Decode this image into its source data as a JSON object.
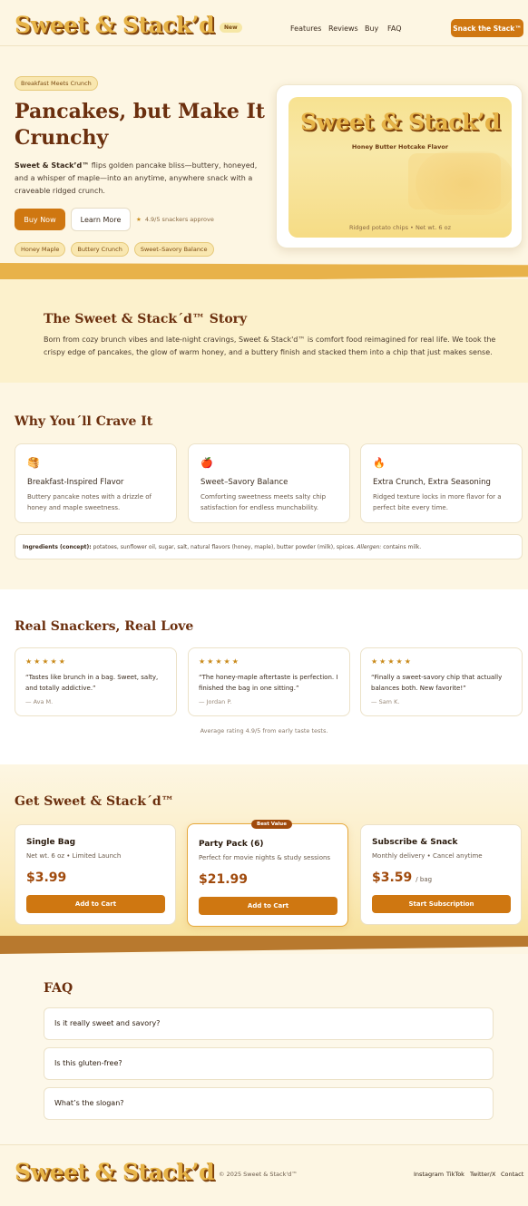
{
  "header": {
    "logo": "Sweet & Stack’d",
    "badge": "New",
    "nav": [
      "Features",
      "Reviews",
      "Buy",
      "FAQ"
    ],
    "cta": "Snack the Stack™"
  },
  "hero": {
    "tag": "Breakfast Meets Crunch",
    "title": "Pancakes, but Make It Crunchy",
    "desc_brand": "Sweet & Stack’d™",
    "desc_rest": " flips golden pancake bliss—buttery, honeyed, and a whisper of maple—into an anytime, anywhere snack with a craveable ridged crunch.",
    "buy_label": "Buy Now",
    "learn_label": "Learn More",
    "rating_text": "4.9/5 snackers approve",
    "flavor_tags": [
      "Honey Maple",
      "Buttery Crunch",
      "Sweet–Savory Balance"
    ]
  },
  "product": {
    "logo": "Sweet & Stack’d",
    "flavor": "Honey Butter Hotcake Flavor",
    "footer": "Ridged potato chips • Net wt. 6 oz"
  },
  "story": {
    "title": "The Sweet & Stack´d™ Story",
    "body": "Born from cozy brunch vibes and late-night cravings, Sweet & Stack'd™ is comfort food reimagined for real life. We took the crispy edge of pancakes, the glow of warm honey, and a buttery finish and stacked them into a chip that just makes sense."
  },
  "why": {
    "title": "Why You´ll Crave It",
    "features": [
      {
        "icon": "pancake-icon",
        "glyph": "🥞",
        "title": "Breakfast-Inspired Flavor",
        "desc": "Buttery pancake notes with a drizzle of honey and maple sweetness."
      },
      {
        "icon": "apple-icon",
        "glyph": "🍎",
        "title": "Sweet–Savory Balance",
        "desc": "Comforting sweetness meets salty chip satisfaction for endless munchability."
      },
      {
        "icon": "fire-icon",
        "glyph": "🔥",
        "title": "Extra Crunch, Extra Seasoning",
        "desc": "Ridged texture locks in more flavor for a perfect bite every time."
      }
    ],
    "ingredients_label": "Ingredients (concept):",
    "ingredients_text": " potatoes, sunflower oil, sugar, salt, natural flavors (honey, maple), butter powder (milk), spices. ",
    "allergen_label": "Allergen:",
    "allergen_text": " contains milk."
  },
  "reviews": {
    "title": "Real Snackers, Real Love",
    "stars": "★★★★★",
    "items": [
      {
        "quote": "“Tastes like brunch in a bag. Sweet, salty, and totally addictive.”",
        "author": "— Ava M."
      },
      {
        "quote": "“The honey-maple aftertaste is perfection. I finished the bag in one sitting.”",
        "author": "— Jordan P."
      },
      {
        "quote": "“Finally a sweet-savory chip that actually balances both. New favorite!”",
        "author": "— Sam K."
      }
    ],
    "average": "Average rating 4.9/5 from early taste tests."
  },
  "pricing": {
    "title": "Get Sweet & Stack´d™",
    "plans": [
      {
        "name": "Single Bag",
        "desc": "Net wt. 6 oz • Limited Launch",
        "price": "$3.99",
        "unit": "",
        "button": "Add to Cart"
      },
      {
        "name": "Party Pack (6)",
        "desc": "Perfect for movie nights & study sessions",
        "price": "$21.99",
        "unit": "",
        "button": "Add to Cart",
        "badge": "Best Value"
      },
      {
        "name": "Subscribe & Snack",
        "desc": "Monthly delivery • Cancel anytime",
        "price": "$3.59",
        "unit": "/ bag",
        "button": "Start Subscription"
      }
    ]
  },
  "faq": {
    "title": "FAQ",
    "items": [
      "Is it really sweet and savory?",
      "Is this gluten-free?",
      "What’s the slogan?"
    ]
  },
  "footer": {
    "logo": "Sweet & Stack’d",
    "copyright": "© 2025 Sweet & Stack'd™",
    "links": [
      "Instagram",
      "TikTok",
      "Twitter/X",
      "Contact"
    ]
  }
}
